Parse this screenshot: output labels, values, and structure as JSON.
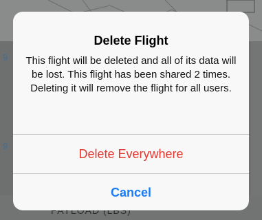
{
  "background": {
    "edge_marks": [
      "9",
      "9"
    ],
    "payload_label": "PAYLOAD (LBS)"
  },
  "alert": {
    "title": "Delete Flight",
    "message": "This flight will be deleted and all of its data will be lost. This flight has been shared 2 times. Deleting it will remove the flight for all users.",
    "actions": {
      "destructive_label": "Delete Everywhere",
      "cancel_label": "Cancel"
    }
  },
  "colors": {
    "destructive": "#e0392f",
    "default_action": "#1a7cf5",
    "overlay": "#6e7070"
  }
}
